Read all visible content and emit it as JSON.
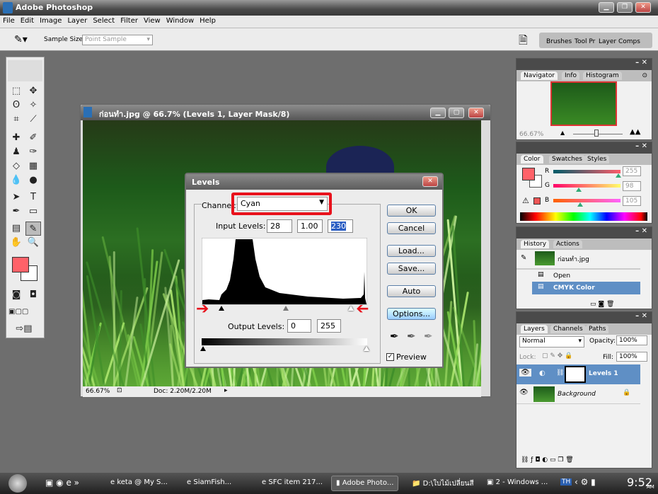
{
  "app": {
    "title": "Adobe Photoshop"
  },
  "menu": [
    "File",
    "Edit",
    "Image",
    "Layer",
    "Select",
    "Filter",
    "View",
    "Window",
    "Help"
  ],
  "options": {
    "sample_size_label": "Sample Size:",
    "sample_size_value": "Point Sample",
    "palette_tabs": [
      "Brushes",
      "Tool Pr",
      "Layer Comps"
    ]
  },
  "document": {
    "title": "ก่อนทำ.jpg @ 66.7% (Levels 1, Layer Mask/8)",
    "zoom": "66.67%",
    "doc_size": "Doc: 2.20M/2.20M"
  },
  "levels": {
    "title": "Levels",
    "channel_label": "Channel:",
    "channel_value": "Cyan",
    "input_label": "Input Levels:",
    "input_black": "28",
    "input_gamma": "1.00",
    "input_white": "230",
    "output_label": "Output Levels:",
    "output_black": "0",
    "output_white": "255",
    "buttons": {
      "ok": "OK",
      "cancel": "Cancel",
      "load": "Load...",
      "save": "Save...",
      "auto": "Auto",
      "options": "Options..."
    },
    "preview_label": "Preview",
    "preview_checked": true,
    "highlight_color": "#e8121c"
  },
  "navigator": {
    "tabs": [
      "Navigator",
      "Info",
      "Histogram"
    ],
    "zoom": "66.67%"
  },
  "color": {
    "tabs": [
      "Color",
      "Swatches",
      "Styles"
    ],
    "r": "255",
    "g": "98",
    "b": "105",
    "foreground": "#ff6269"
  },
  "history": {
    "tabs": [
      "History",
      "Actions"
    ],
    "snapshot": "ก่อนทำ.jpg",
    "items": [
      "Open",
      "CMYK Color"
    ],
    "selected": "CMYK Color"
  },
  "layers": {
    "tabs": [
      "Layers",
      "Channels",
      "Paths"
    ],
    "blend_mode": "Normal",
    "opacity_label": "Opacity:",
    "opacity": "100%",
    "lock_label": "Lock:",
    "fill_label": "Fill:",
    "fill": "100%",
    "items": [
      {
        "name": "Levels 1",
        "selected": true
      },
      {
        "name": "Background",
        "locked": true
      }
    ]
  },
  "taskbar": {
    "items": [
      "keta @ My S...",
      "SiamFish...",
      "SFC item 217...",
      "Adobe Photo...",
      "D:\\ใบไม้เปลี่ยนสี",
      "2 - Windows ..."
    ],
    "active": "Adobe Photo...",
    "lang": "TH",
    "time": "9:52",
    "ampm": "AM"
  }
}
